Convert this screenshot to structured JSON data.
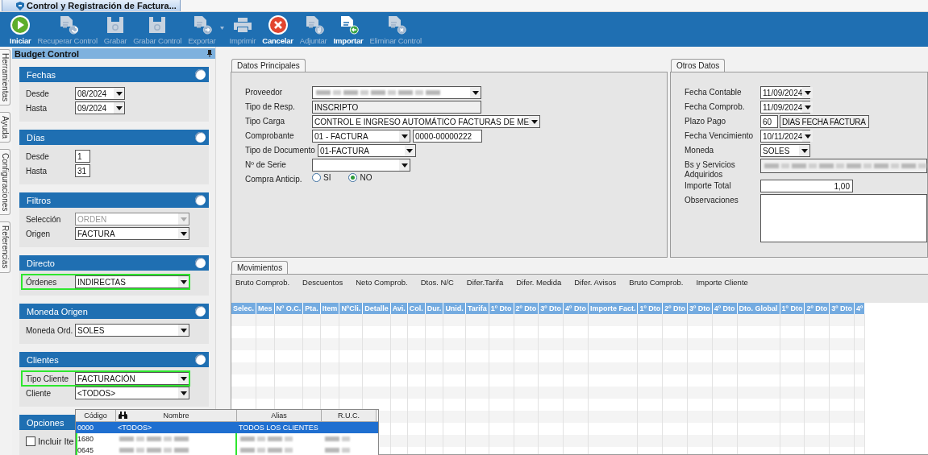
{
  "document_tab": {
    "title": "Control y Registración de Factura..."
  },
  "toolbar": [
    {
      "label": "Iniciar",
      "kind": "play",
      "enabled": true,
      "has_menu": false
    },
    {
      "label": "Recuperar Control",
      "kind": "doc-refresh",
      "enabled": false,
      "has_menu": false
    },
    {
      "label": "Grabar",
      "kind": "save",
      "enabled": false,
      "has_menu": false
    },
    {
      "label": "Grabar Control",
      "kind": "save",
      "enabled": false,
      "has_menu": false
    },
    {
      "label": "Exportar",
      "kind": "doc-export",
      "enabled": false,
      "has_menu": true
    },
    {
      "label": "Imprimir",
      "kind": "print",
      "enabled": false,
      "has_menu": false
    },
    {
      "label": "Cancelar",
      "kind": "cancel",
      "enabled": true,
      "has_menu": false
    },
    {
      "label": "Adjuntar",
      "kind": "doc-attach",
      "enabled": false,
      "has_menu": false
    },
    {
      "label": "Importar",
      "kind": "doc-import",
      "enabled": true,
      "has_menu": false
    },
    {
      "label": "Eliminar Control",
      "kind": "doc-delete",
      "enabled": false,
      "has_menu": false
    }
  ],
  "side_tabs": [
    "Herramientas",
    "Ayuda",
    "Configuraciones",
    "Referencias"
  ],
  "left_panel": {
    "title": "Budget Control",
    "sections": [
      {
        "title": "Fechas",
        "rows": [
          {
            "label": "Desde",
            "kind": "combo_short",
            "value": "08/2024",
            "highlighted": false
          },
          {
            "label": "Hasta",
            "kind": "combo_short",
            "value": "09/2024",
            "highlighted": false
          }
        ]
      },
      {
        "title": "Días",
        "rows": [
          {
            "label": "Desde",
            "kind": "number",
            "value": "1",
            "highlighted": false
          },
          {
            "label": "Hasta",
            "kind": "number",
            "value": "31",
            "highlighted": false
          }
        ]
      },
      {
        "title": "Filtros",
        "rows": [
          {
            "label": "Selección",
            "kind": "combo",
            "value": "ORDEN",
            "disabled": true,
            "highlighted": false
          },
          {
            "label": "Origen",
            "kind": "combo",
            "value": "FACTURA",
            "disabled": false,
            "highlighted": false
          }
        ]
      },
      {
        "title": "Directo",
        "rows": [
          {
            "label": "Órdenes",
            "kind": "combo",
            "value": "INDIRECTAS",
            "disabled": false,
            "highlighted": true
          }
        ]
      },
      {
        "title": "Moneda Origen",
        "rows": [
          {
            "label": "Moneda Ord.",
            "kind": "combo",
            "value": "SOLES",
            "disabled": false,
            "highlighted": false
          }
        ]
      },
      {
        "title": "Clientes",
        "rows": [
          {
            "label": "Tipo Cliente",
            "kind": "combo",
            "value": "FACTURACIÓN",
            "disabled": false,
            "highlighted": true
          },
          {
            "label": "Cliente",
            "kind": "combo",
            "value": "<TODOS>",
            "disabled": false,
            "highlighted": false
          }
        ]
      },
      {
        "title": "Opciones",
        "rows": [
          {
            "label": "Incluir Ite",
            "kind": "checkbox",
            "checked": false,
            "highlighted": false
          }
        ]
      }
    ]
  },
  "client_dropdown": {
    "columns": [
      {
        "label": "Código",
        "highlighted": true,
        "kind": "plain"
      },
      {
        "label": "Nombre",
        "highlighted": true,
        "kind": "search"
      },
      {
        "label": "Alias",
        "highlighted": false,
        "kind": "plain"
      },
      {
        "label": "R.U.C.",
        "highlighted": false,
        "kind": "plain"
      }
    ],
    "rows": [
      {
        "selected": true,
        "cells": [
          {
            "text": "0000"
          },
          {
            "text": "<TODOS>"
          },
          {
            "text": "TODOS LOS CLIENTES"
          },
          {
            "kind": "blank"
          }
        ]
      },
      {
        "selected": false,
        "cells": [
          {
            "text": "1680"
          },
          {
            "kind": "redacted"
          },
          {
            "kind": "redacted"
          },
          {
            "kind": "redacted"
          }
        ]
      },
      {
        "selected": false,
        "cells": [
          {
            "text": "0645"
          },
          {
            "kind": "redacted"
          },
          {
            "kind": "redacted"
          },
          {
            "kind": "redacted"
          }
        ]
      }
    ]
  },
  "main_data": {
    "tab": "Datos Principales",
    "rows": [
      {
        "label": "Proveedor",
        "fields": [
          {
            "kind": "combo_long",
            "redacted": true
          }
        ]
      },
      {
        "label": "Tipo de Resp.",
        "fields": [
          {
            "kind": "readonly_long",
            "value": "INSCRIPTO"
          }
        ]
      },
      {
        "label": "Tipo Carga",
        "fields": [
          {
            "kind": "combo_long",
            "value": "CONTROL E INGRESO AUTOMÁTICO FACTURAS DE ME"
          }
        ]
      },
      {
        "label": "Comprobante",
        "fields": [
          {
            "kind": "combo",
            "value": "01 - FACTURA"
          },
          {
            "kind": "text",
            "value": "0000-00000222"
          }
        ]
      },
      {
        "label": "Tipo de Documento",
        "fields": [
          {
            "kind": "combo",
            "value": "01-FACTURA"
          }
        ]
      },
      {
        "label": "Nº de Serie",
        "fields": [
          {
            "kind": "combo"
          }
        ]
      },
      {
        "label": "Compra Anticip.",
        "fields": [
          {
            "kind": "radio",
            "options": [
              {
                "label": "SI",
                "selected": false
              },
              {
                "label": "NO",
                "selected": true
              }
            ]
          }
        ]
      }
    ]
  },
  "other_data": {
    "tab": "Otros Datos",
    "rows": [
      {
        "label": "Fecha Contable",
        "fields": [
          {
            "kind": "combo_short",
            "value": "11/09/2024"
          }
        ]
      },
      {
        "label": "Fecha Comprob.",
        "fields": [
          {
            "kind": "combo_short",
            "value": "11/09/2024"
          }
        ]
      },
      {
        "label": "Plazo Pago",
        "fields": [
          {
            "kind": "number",
            "value": "60"
          },
          {
            "kind": "readonly",
            "value": "DIAS FECHA FACTURA"
          }
        ]
      },
      {
        "label": "Fecha Vencimiento",
        "fields": [
          {
            "kind": "combo_short",
            "value": "10/11/2024"
          }
        ]
      },
      {
        "label": "Moneda",
        "fields": [
          {
            "kind": "combo_short",
            "value": "SOLES"
          }
        ]
      },
      {
        "label": "Bs y Servicios Adquiridos",
        "fields": [
          {
            "kind": "readonly_fill",
            "redacted": true
          }
        ]
      },
      {
        "label": "Importe Total",
        "fields": [
          {
            "kind": "amount",
            "value": "1,00"
          }
        ]
      },
      {
        "label": "Observaciones",
        "fields": [
          {
            "kind": "memo"
          }
        ]
      }
    ]
  },
  "movements": {
    "tab": "Movimientos",
    "summary": [
      "Bruto Comprob.",
      "Descuentos",
      "Neto Comprob.",
      "Dtos. N/C",
      "Difer.Tarifa",
      "Difer. Medida",
      "Difer. Avisos",
      "Bruto Comprob.",
      "Importe Cliente"
    ],
    "columns": [
      "Selec.",
      "Mes",
      "Nº O.C.",
      "Pta.",
      "Item",
      "NºCli.",
      "Detalle",
      "Avi.",
      "Col.",
      "Dur.",
      "Unid.",
      "Tarifa",
      "1º Dto",
      "2º Dto",
      "3º Dto",
      "4º Dto",
      "Importe Fact.",
      "1º Dto",
      "2º Dto",
      "3º Dto",
      "4º Dto",
      "Dto. Global",
      "1º Dto",
      "2º Dto",
      "3º Dto",
      "4º"
    ]
  }
}
